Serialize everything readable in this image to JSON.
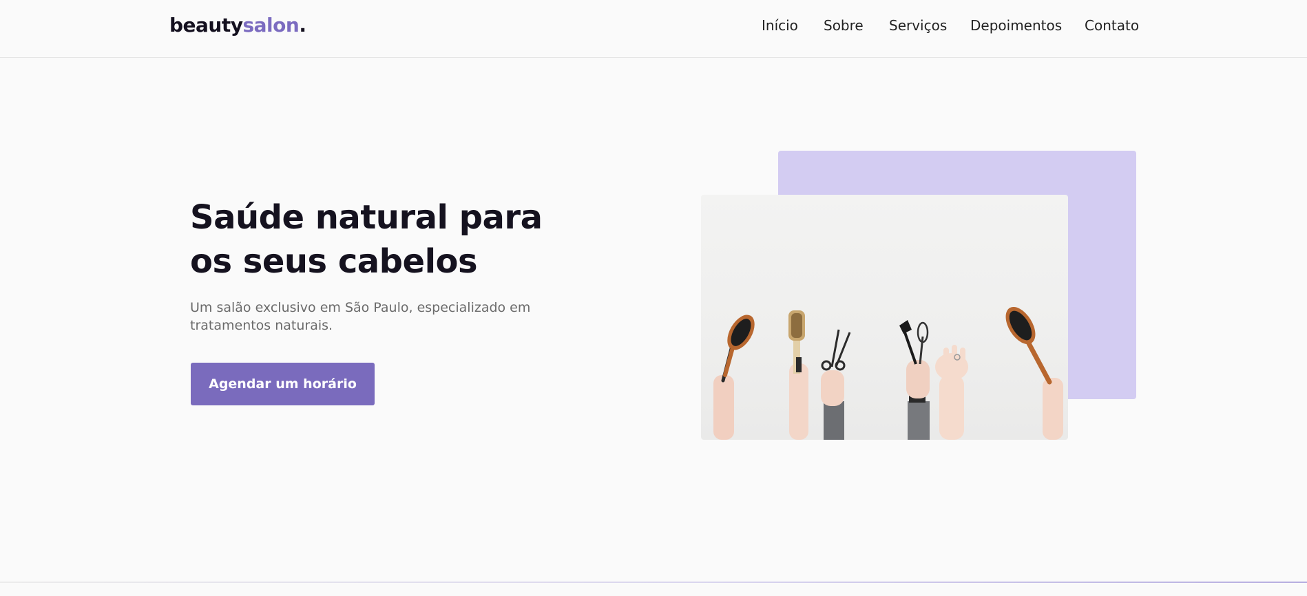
{
  "header": {
    "logo": {
      "part1": "beauty",
      "part2": "salon",
      "dot": "."
    },
    "nav": [
      "Início",
      "Sobre",
      "Serviços",
      "Depoimentos",
      "Contato"
    ]
  },
  "hero": {
    "title_line1": "Saúde natural para",
    "title_line2": "os seus cabelos",
    "subtitle": "Um salão exclusivo em São Paulo, especializado em tratamentos naturais.",
    "cta_label": "Agendar um horário"
  },
  "colors": {
    "accent": "#7a6bbd",
    "accent_light": "#d3ccf2",
    "text_dark": "#15121f",
    "text_muted": "#6b6b6b",
    "background": "#fafafa"
  }
}
